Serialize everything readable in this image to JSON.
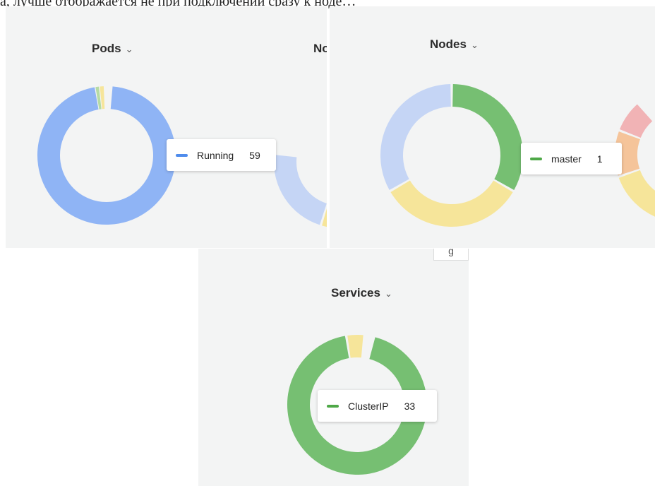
{
  "background_text": "а, лучше отображается не при подключении сразу к ноде…",
  "panels": {
    "pods": {
      "title": "Pods",
      "neighbor_title_clip": "No",
      "tooltip": {
        "label": "Running",
        "value": "59",
        "color": "#4f8cec"
      }
    },
    "nodes": {
      "title": "Nodes",
      "tooltip": {
        "label": "master",
        "value": "1",
        "color": "#4ea847"
      }
    },
    "services": {
      "title": "Services",
      "tooltip": {
        "label": "ClusterIP",
        "value": "33",
        "color": "#4ea847"
      }
    }
  },
  "partial_button_text": "g",
  "colors": {
    "panel_bg": "#f3f4f4",
    "blue": "#8fb4f5",
    "light_blue": "#c5d5f5",
    "green": "#76bf72",
    "yellow": "#f6e59a",
    "orange": "#f5c49a",
    "pink": "#f1b3b5",
    "light_green": "#b5dba4"
  },
  "chart_data": [
    {
      "type": "pie",
      "title": "Pods",
      "categories": [
        "Running",
        "",
        ""
      ],
      "values": [
        59,
        1,
        1
      ]
    },
    {
      "type": "pie",
      "title": "Nodes",
      "categories": [
        "master",
        "",
        ""
      ],
      "values": [
        1,
        1,
        1
      ]
    },
    {
      "type": "pie",
      "title": "Services",
      "categories": [
        "ClusterIP",
        ""
      ],
      "values": [
        33,
        1
      ]
    }
  ]
}
